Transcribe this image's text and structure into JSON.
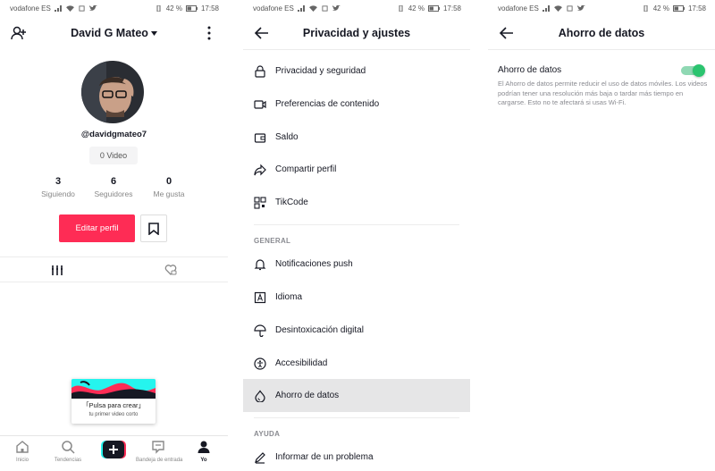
{
  "status": {
    "carrier": "vodafone ES",
    "battery": "42 %",
    "time": "17:58"
  },
  "profile": {
    "username": "David G Mateo",
    "handle": "@davidgmateo7",
    "videos": "0 Video",
    "stats": [
      {
        "num": "3",
        "label": "Siguiendo"
      },
      {
        "num": "6",
        "label": "Seguidores"
      },
      {
        "num": "0",
        "label": "Me gusta"
      }
    ],
    "edit_label": "Editar perfil",
    "popup_line1": "「Pulsa para crear」",
    "popup_line2": "tu primer video corto",
    "nav": [
      {
        "label": "Inicio"
      },
      {
        "label": "Tendencias"
      },
      {
        "label": "Bandeja de entrada"
      },
      {
        "label": "Yo"
      }
    ],
    "colors": {
      "accent": "#fe2c55",
      "cyan": "#25f4ee"
    }
  },
  "settings": {
    "title": "Privacidad y ajustes",
    "items": [
      {
        "label": "Privacidad y seguridad",
        "icon": "lock-icon"
      },
      {
        "label": "Preferencias de contenido",
        "icon": "video-icon"
      },
      {
        "label": "Saldo",
        "icon": "wallet-icon"
      },
      {
        "label": "Compartir perfil",
        "icon": "share-icon"
      },
      {
        "label": "TikCode",
        "icon": "qr-icon"
      }
    ],
    "general_header": "GENERAL",
    "general_items": [
      {
        "label": "Notificaciones push",
        "icon": "bell-icon"
      },
      {
        "label": "Idioma",
        "icon": "language-icon"
      },
      {
        "label": "Desintoxicación digital",
        "icon": "umbrella-icon"
      },
      {
        "label": "Accesibilidad",
        "icon": "accessibility-icon"
      },
      {
        "label": "Ahorro de datos",
        "icon": "data-saver-icon",
        "active": true
      }
    ],
    "help_header": "AYUDA",
    "help_items": [
      {
        "label": "Informar de un problema",
        "icon": "pencil-icon"
      }
    ]
  },
  "datasaver": {
    "title": "Ahorro de datos",
    "option_label": "Ahorro de datos",
    "description": "El Ahorro de datos permite reducir el uso de datos móviles. Los videos podrían tener una resolución más baja o tardar más tiempo en cargarse. Esto no te afectará si usas Wi-Fi.",
    "enabled": true,
    "toggle_color": "#2bc46f"
  }
}
